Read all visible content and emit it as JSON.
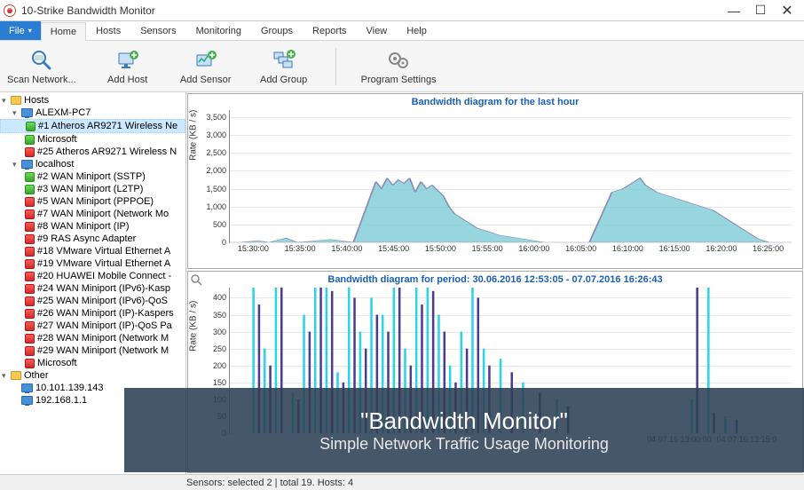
{
  "window": {
    "title": "10-Strike Bandwidth Monitor",
    "minimize": "—",
    "maximize": "☐",
    "close": "✕"
  },
  "menu": {
    "file": "File",
    "tabs": [
      "Home",
      "Hosts",
      "Sensors",
      "Monitoring",
      "Groups",
      "Reports",
      "View",
      "Help"
    ],
    "active": 0
  },
  "ribbon": {
    "scan": "Scan Network...",
    "add_host": "Add Host",
    "add_sensor": "Add Sensor",
    "add_group": "Add Group",
    "settings": "Program Settings"
  },
  "tree": {
    "root": "Hosts",
    "groups": [
      {
        "name": "ALEXM-PC7",
        "items": [
          {
            "color": "green",
            "label": "#1 Atheros AR9271 Wireless Ne",
            "selected": true
          },
          {
            "color": "green",
            "label": "Microsoft"
          },
          {
            "color": "red",
            "label": "#25 Atheros AR9271 Wireless N"
          }
        ]
      },
      {
        "name": "localhost",
        "items": [
          {
            "color": "green",
            "label": "#2 WAN Miniport (SSTP)"
          },
          {
            "color": "green",
            "label": "#3 WAN Miniport (L2TP)"
          },
          {
            "color": "red",
            "label": "#5 WAN Miniport (PPPOE)"
          },
          {
            "color": "red",
            "label": "#7 WAN Miniport (Network Mo"
          },
          {
            "color": "red",
            "label": "#8 WAN Miniport (IP)"
          },
          {
            "color": "red",
            "label": "#9 RAS Async Adapter"
          },
          {
            "color": "red",
            "label": "#18 VMware Virtual Ethernet A"
          },
          {
            "color": "red",
            "label": "#19 VMware Virtual Ethernet A"
          },
          {
            "color": "red",
            "label": "#20 HUAWEI Mobile Connect -"
          },
          {
            "color": "red",
            "label": "#24 WAN Miniport (IPv6)-Kasp"
          },
          {
            "color": "red",
            "label": "#25 WAN Miniport (IPv6)-QoS"
          },
          {
            "color": "red",
            "label": "#26 WAN Miniport (IP)-Kaspers"
          },
          {
            "color": "red",
            "label": "#27 WAN Miniport (IP)-QoS Pa"
          },
          {
            "color": "red",
            "label": "#28 WAN Miniport (Network M"
          },
          {
            "color": "red",
            "label": "#29 WAN Miniport (Network M"
          },
          {
            "color": "red",
            "label": "Microsoft"
          }
        ]
      }
    ],
    "other": {
      "name": "Other",
      "items": [
        {
          "label": "10.101.139.143"
        },
        {
          "label": "192.168.1.1"
        }
      ]
    }
  },
  "chart_data": [
    {
      "type": "area",
      "title": "Bandwidth diagram for the last hour",
      "ylabel": "Rate (KB / s)",
      "yticks": [
        0,
        500,
        1000,
        1500,
        2000,
        2500,
        3000,
        3500
      ],
      "ylim": [
        0,
        3700
      ],
      "xticks": [
        "15:30:00",
        "15:35:00",
        "15:40:00",
        "15:45:00",
        "15:50:00",
        "15:55:00",
        "16:00:00",
        "16:05:00",
        "16:10:00",
        "16:15:00",
        "16:20:00",
        "16:25:00"
      ],
      "series": [
        {
          "name": "bandwidth",
          "color_fill": "#74c8d4",
          "color_line": "#8a8db8",
          "x_frac": [
            0.02,
            0.05,
            0.07,
            0.1,
            0.12,
            0.18,
            0.22,
            0.26,
            0.27,
            0.28,
            0.29,
            0.3,
            0.31,
            0.32,
            0.33,
            0.34,
            0.35,
            0.36,
            0.37,
            0.38,
            0.39,
            0.4,
            0.42,
            0.44,
            0.46,
            0.48,
            0.5,
            0.52,
            0.54,
            0.56,
            0.58,
            0.6,
            0.62,
            0.64,
            0.68,
            0.7,
            0.72,
            0.73,
            0.74,
            0.75,
            0.76,
            0.78,
            0.8,
            0.82,
            0.84,
            0.86,
            0.88,
            0.9,
            0.92,
            0.94,
            0.96
          ],
          "values": [
            0,
            50,
            0,
            120,
            0,
            80,
            0,
            1700,
            1500,
            1800,
            1600,
            1750,
            1650,
            1800,
            1400,
            1700,
            1500,
            1600,
            1450,
            1300,
            1000,
            800,
            600,
            400,
            300,
            200,
            150,
            100,
            50,
            0,
            0,
            0,
            0,
            0,
            1400,
            1500,
            1700,
            1800,
            1600,
            1500,
            1400,
            1300,
            1200,
            1100,
            1000,
            900,
            700,
            500,
            300,
            100,
            0
          ]
        }
      ]
    },
    {
      "type": "bar",
      "title": "Bandwidth diagram for period: 30.06.2016 12:53:05 - 07.07.2016 16:26:43",
      "ylabel": "Rate (KB / s)",
      "yticks": [
        0,
        50,
        100,
        150,
        200,
        250,
        300,
        350,
        400
      ],
      "ylim": [
        0,
        430
      ],
      "xticks": [
        "04.07.16 13:00:00",
        "04.07.16 13:15:0"
      ],
      "series": [
        {
          "name": "series-a",
          "color": "#4a3d8f",
          "x_frac": [
            0.05,
            0.07,
            0.09,
            0.12,
            0.14,
            0.16,
            0.18,
            0.2,
            0.22,
            0.24,
            0.26,
            0.28,
            0.3,
            0.32,
            0.34,
            0.36,
            0.38,
            0.4,
            0.42,
            0.44,
            0.46,
            0.5,
            0.55,
            0.6,
            0.83,
            0.86,
            0.9
          ],
          "values": [
            380,
            200,
            430,
            100,
            300,
            430,
            420,
            150,
            400,
            250,
            350,
            300,
            430,
            200,
            380,
            420,
            300,
            150,
            250,
            400,
            200,
            180,
            120,
            80,
            430,
            60,
            40
          ]
        },
        {
          "name": "series-b",
          "color": "#2ad4e6",
          "x_frac": [
            0.04,
            0.06,
            0.08,
            0.11,
            0.13,
            0.15,
            0.17,
            0.19,
            0.21,
            0.23,
            0.25,
            0.27,
            0.29,
            0.31,
            0.33,
            0.35,
            0.37,
            0.39,
            0.41,
            0.43,
            0.45,
            0.48,
            0.52,
            0.58,
            0.82,
            0.85,
            0.88
          ],
          "values": [
            430,
            250,
            430,
            120,
            350,
            430,
            430,
            180,
            430,
            300,
            400,
            350,
            430,
            250,
            430,
            430,
            350,
            200,
            300,
            430,
            250,
            220,
            150,
            100,
            100,
            430,
            50
          ]
        }
      ]
    }
  ],
  "statusbar": {
    "text": "Sensors: selected 2 | total 19. Hosts: 4"
  },
  "overlay": {
    "title": "\"Bandwidth Monitor\"",
    "subtitle": "Simple Network Traffic Usage Monitoring"
  }
}
